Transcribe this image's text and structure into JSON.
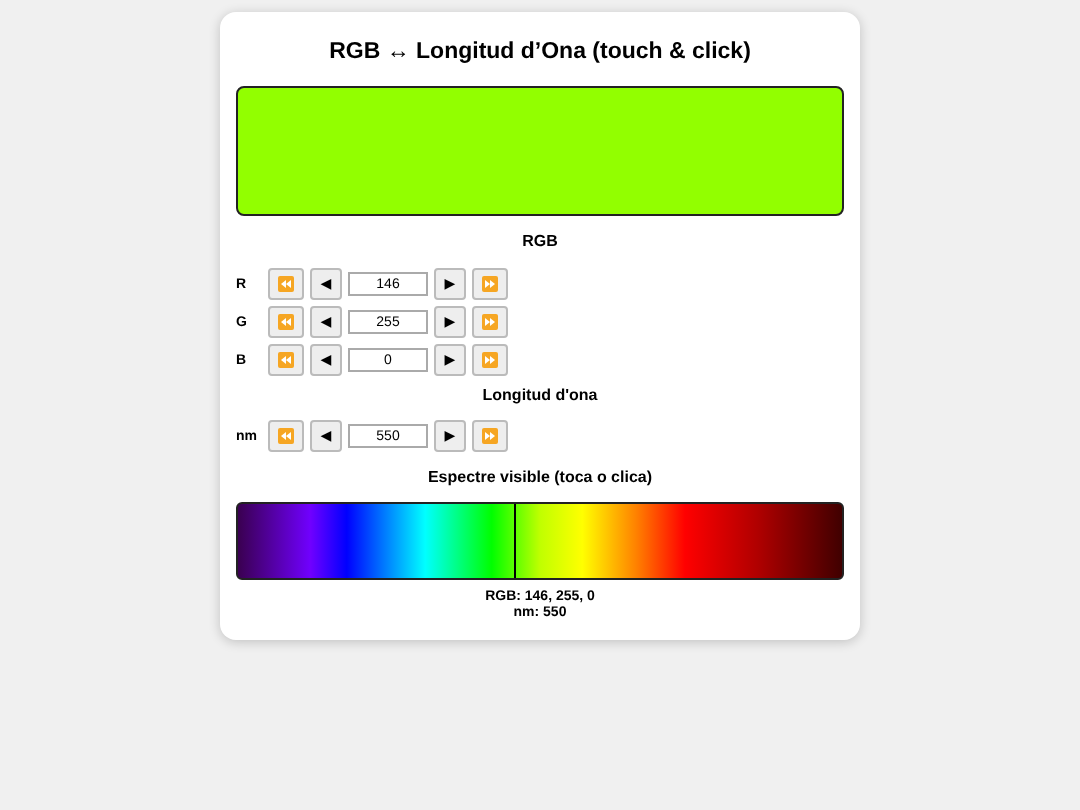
{
  "title": "RGB ↔ Longitud d’Ona (touch & click)",
  "swatch": {
    "color": "#92ff00"
  },
  "rgb_heading": "RGB",
  "rgb_rows": [
    {
      "label": "R",
      "value": "146",
      "back_glyph": "◀",
      "forward_glyph": "▶"
    },
    {
      "label": "G",
      "value": "255",
      "back_glyph": "◀",
      "forward_glyph": "▶"
    },
    {
      "label": "B",
      "value": "0",
      "back_glyph": "◀",
      "forward_glyph": "▶"
    }
  ],
  "wavelength_heading": "Longitud d'ona",
  "wavelength_row": {
    "label": "nm",
    "value": "550",
    "back_glyph": "◀",
    "forward_glyph": "▶"
  },
  "spectrum_heading": "Espectre visible (toca o clica)",
  "spectrum_marker": {
    "level": 0.457
  },
  "readout": [
    "RGB: 146, 255, 0",
    "nm: 550"
  ]
}
